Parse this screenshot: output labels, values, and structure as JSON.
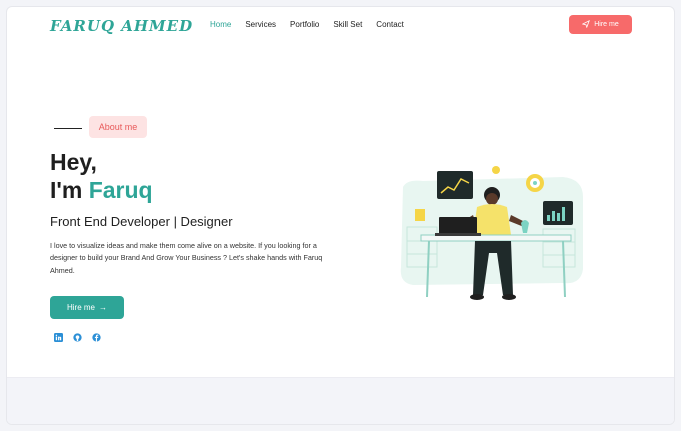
{
  "brand": {
    "logo_text": "FARUQ AHMED"
  },
  "nav": {
    "items": [
      {
        "label": "Home",
        "active": true
      },
      {
        "label": "Services",
        "active": false
      },
      {
        "label": "Portfolio",
        "active": false
      },
      {
        "label": "Skill Set",
        "active": false
      },
      {
        "label": "Contact",
        "active": false
      }
    ],
    "hire_label": "Hire me"
  },
  "hero": {
    "chip_label": "About me",
    "greeting": "Hey,",
    "intro_prefix": "I'm ",
    "intro_name": "Faruq",
    "role": "Front End Developer | Designer",
    "bio": "I love to visualize ideas and make them come alive on a website. If you looking for a designer to build your Brand And Grow Your Business ? Let's shake hands with Faruq Ahmed.",
    "cta_label": "Hire me",
    "cta_arrow": "→"
  },
  "socials": [
    {
      "icon": "linkedin-icon"
    },
    {
      "icon": "github-icon"
    },
    {
      "icon": "facebook-icon"
    }
  ],
  "colors": {
    "accent": "#2ea597",
    "cta_red": "#f76a6a",
    "chip_bg": "#fde3e3",
    "social_blue": "#2b8fd6"
  }
}
